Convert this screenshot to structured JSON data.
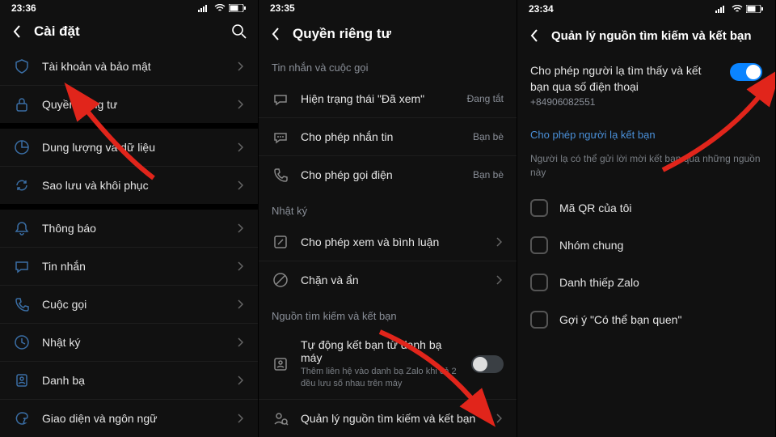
{
  "pane1": {
    "time": "23:36",
    "title": "Cài đặt",
    "items": [
      {
        "label": "Tài khoản và bảo mật"
      },
      {
        "label": "Quyền riêng tư"
      },
      {
        "label": "Dung lượng và dữ liệu"
      },
      {
        "label": "Sao lưu và khôi phục"
      },
      {
        "label": "Thông báo"
      },
      {
        "label": "Tin nhắn"
      },
      {
        "label": "Cuộc gọi"
      },
      {
        "label": "Nhật ký"
      },
      {
        "label": "Danh bạ"
      },
      {
        "label": "Giao diện và ngôn ngữ"
      }
    ]
  },
  "pane2": {
    "time": "23:35",
    "title": "Quyền riêng tư",
    "sections": {
      "s1": "Tin nhắn và cuộc gọi",
      "s2": "Nhật ký",
      "s3": "Nguồn tìm kiếm và kết bạn"
    },
    "rows": {
      "seen": {
        "label": "Hiện trạng thái \"Đã xem\"",
        "status": "Đang tắt"
      },
      "msg": {
        "label": "Cho phép nhắn tin",
        "status": "Bạn bè"
      },
      "call": {
        "label": "Cho phép gọi điện",
        "status": "Bạn bè"
      },
      "view": {
        "label": "Cho phép xem và bình luận"
      },
      "block": {
        "label": "Chặn và ẩn"
      },
      "auto": {
        "label": "Tự động kết bạn từ danh bạ máy",
        "sub": "Thêm liên hệ vào danh bạ Zalo khi cả 2 đều lưu số nhau trên máy"
      },
      "manage": {
        "label": "Quản lý nguồn tìm kiếm và kết bạn"
      }
    }
  },
  "pane3": {
    "time": "23:34",
    "title": "Quản lý nguồn tìm kiếm và kết bạn",
    "findToggle": {
      "title": "Cho phép người lạ tìm thấy và kết bạn qua số điện thoại",
      "sub": "+84906082551"
    },
    "section": "Cho phép người lạ kết bạn",
    "desc": "Người lạ có thể gửi lời mời kết bạn qua những nguồn này",
    "options": [
      {
        "label": "Mã QR của tôi"
      },
      {
        "label": "Nhóm chung"
      },
      {
        "label": "Danh thiếp Zalo"
      },
      {
        "label": "Gợi ý \"Có thể bạn quen\""
      }
    ]
  }
}
